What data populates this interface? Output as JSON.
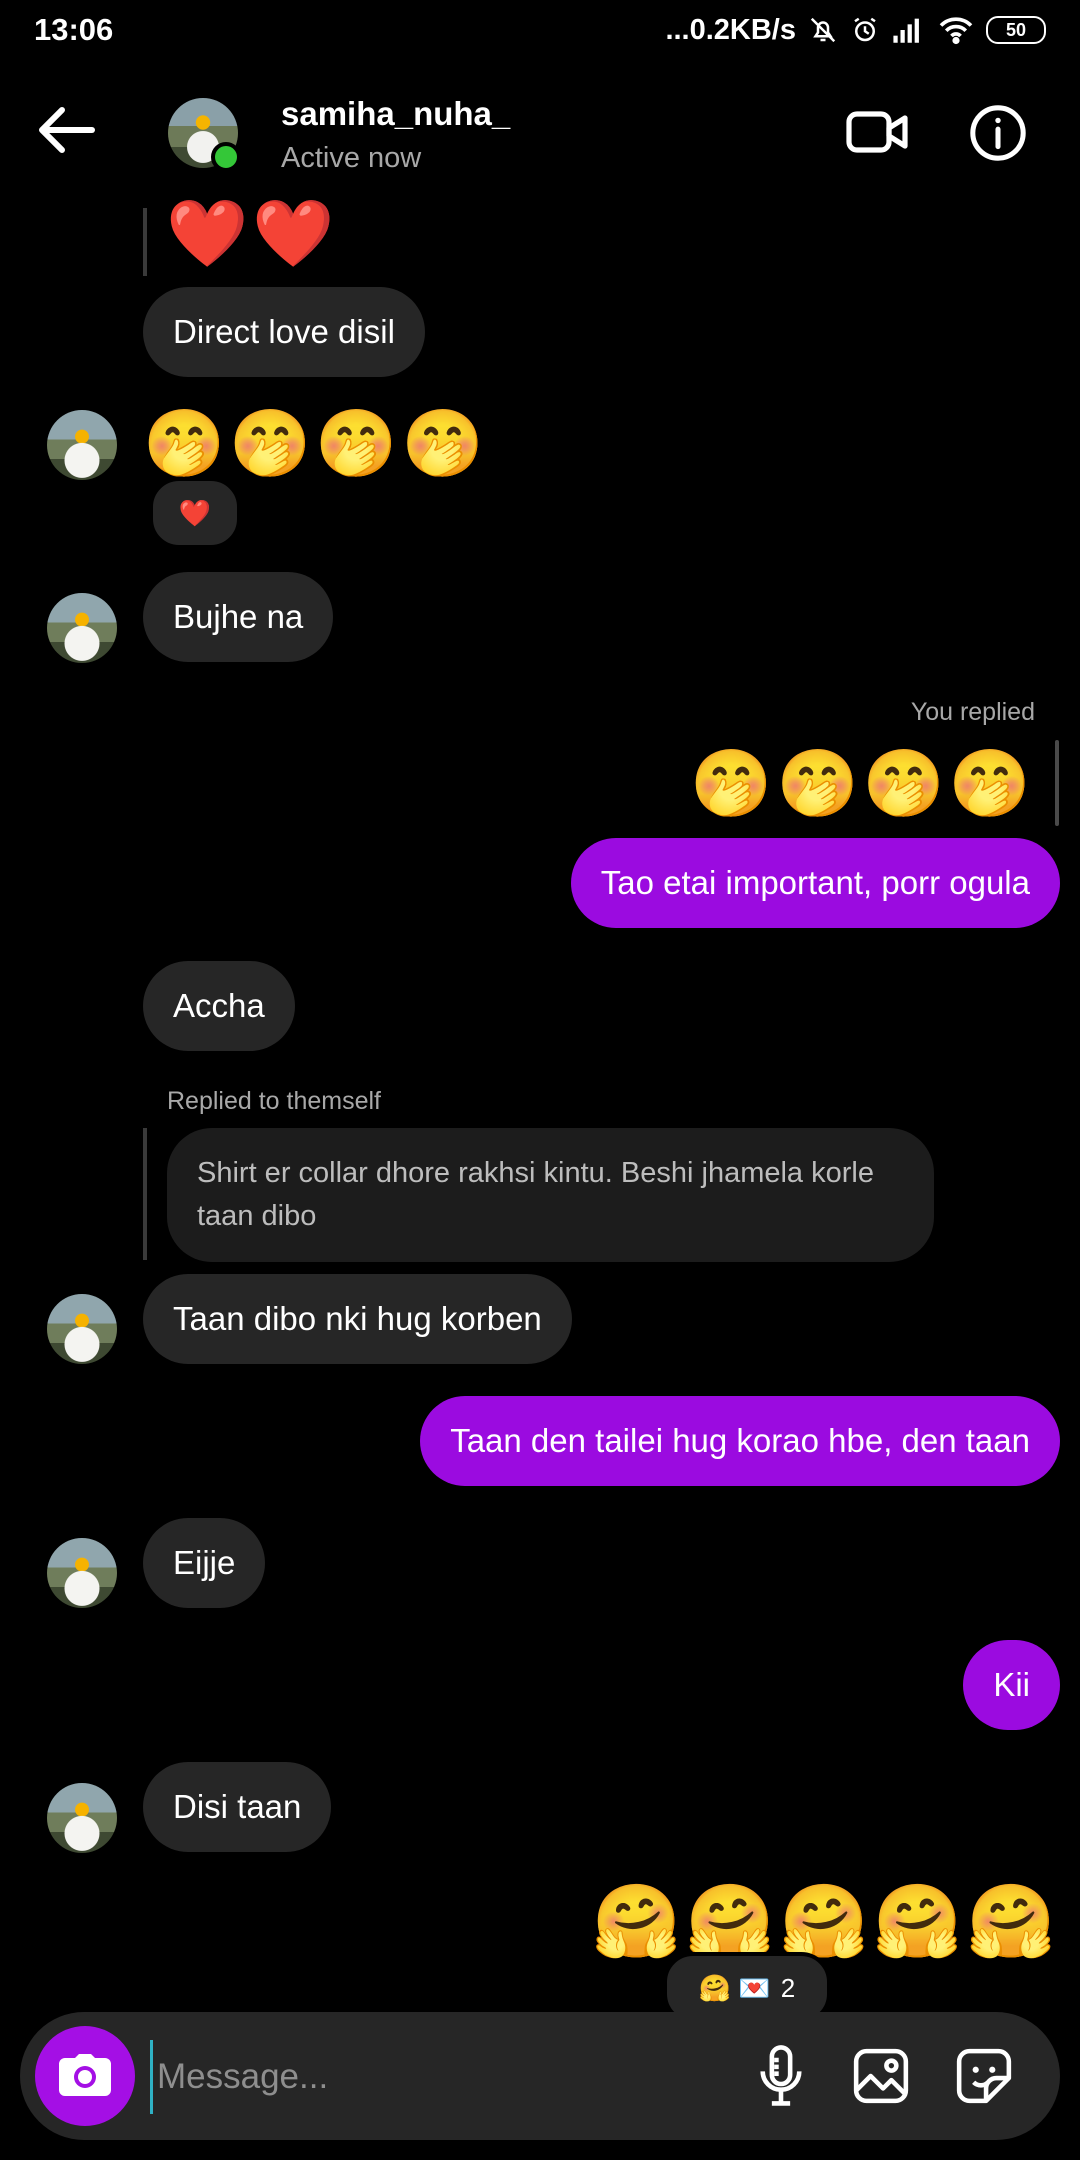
{
  "status_bar": {
    "time": "13:06",
    "network_speed": "...0.2KB/s",
    "battery": "50",
    "icons": [
      "mute-bell-icon",
      "alarm-icon",
      "signal-icon",
      "wifi-icon",
      "battery-icon"
    ]
  },
  "header": {
    "username": "samiha_nuha_",
    "status": "Active now",
    "icons": [
      "back-arrow-icon",
      "video-call-icon",
      "info-icon"
    ],
    "online_color": "#34c738"
  },
  "messages": {
    "hearts": "❤️❤️",
    "m1": "Direct love disil",
    "m2_emojis": "🤭🤭🤭🤭",
    "m2_reaction": "❤️",
    "m3": "Bujhe na",
    "you_replied": "You replied",
    "m4_emojis": "🤭🤭🤭🤭",
    "m5": "Tao etai important, porr ogula",
    "m6": "Accha",
    "replied_label": "Replied to themself",
    "replied_quote": "Shirt er collar dhore rakhsi kintu. Beshi jhamela korle taan dibo",
    "m7": "Taan dibo nki hug korben",
    "m8": "Taan den tailei hug korao hbe, den taan",
    "m9": "Eijje",
    "m10": "Kii",
    "m11": "Disi taan",
    "m12_emojis": "🤗🤗🤗🤗🤗",
    "m12_reaction_emojis": "🤗 💌",
    "m12_reaction_count": "2"
  },
  "composer": {
    "placeholder": "Message...",
    "icons": [
      "camera-icon",
      "microphone-icon",
      "gallery-icon",
      "sticker-icon"
    ]
  },
  "colors": {
    "outgoing_bubble": "#9b0be0",
    "incoming_bubble": "#262626",
    "camera_button": "#a40fe5"
  }
}
